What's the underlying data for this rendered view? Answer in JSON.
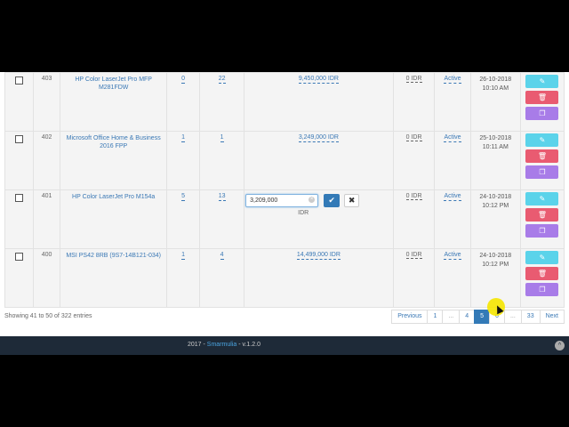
{
  "rows": [
    {
      "id": "403",
      "name": "HP Color LaserJet Pro MFP M281FDW",
      "qty1": "0",
      "qty2": "22",
      "price": "9,450,000 IDR",
      "idr": "0 IDR",
      "status": "Active",
      "date": "26-10-2018",
      "time": "10:10 AM"
    },
    {
      "id": "402",
      "name": "Microsoft Office Home & Business 2016 FPP",
      "qty1": "1",
      "qty2": "1",
      "price": "3,249,000 IDR",
      "idr": "0 IDR",
      "status": "Active",
      "date": "25-10-2018",
      "time": "10:11 AM"
    },
    {
      "id": "401",
      "name": "HP Color LaserJet Pro M154a",
      "qty1": "5",
      "qty2": "13",
      "price": "",
      "idr": "0 IDR",
      "status": "Active",
      "date": "24-10-2018",
      "time": "10:12 PM"
    },
    {
      "id": "400",
      "name": "MSI PS42 8RB (9S7-14B121-034)",
      "qty1": "1",
      "qty2": "4",
      "price": "14,499,000 IDR",
      "idr": "0 IDR",
      "status": "Active",
      "date": "24-10-2018",
      "time": "10:12 PM"
    }
  ],
  "inline_edit": {
    "value": "3,209,000",
    "unit": "IDR",
    "ok_icon": "check-icon",
    "cancel_icon": "close-icon",
    "ok_glyph": "✔",
    "cancel_glyph": "✖"
  },
  "actions": {
    "edit_icon": "pencil-icon",
    "delete_icon": "trash-icon",
    "copy_icon": "copy-icon"
  },
  "table_info": "Showing 41 to 50 of 322 entries",
  "pagination": {
    "previous": "Previous",
    "p1": "1",
    "ell1": "...",
    "p4": "4",
    "p5": "5",
    "p6": "6",
    "ell2": "...",
    "p33": "33",
    "next": "Next"
  },
  "footer": {
    "year": "2017 - ",
    "brand": "Smarmulia",
    "version": " - v.1.2.0",
    "scroll_glyph": "^"
  },
  "colors": {
    "edit": "#5bd3ea",
    "delete": "#e95b71",
    "copy": "#a87ce8",
    "primary": "#337ab7",
    "footer": "#1e2a38"
  }
}
